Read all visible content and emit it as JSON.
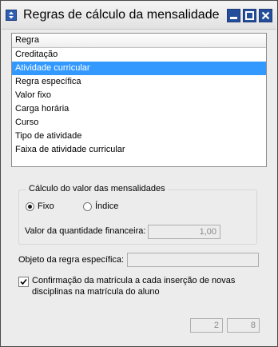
{
  "window": {
    "title": "Regras de cálculo da mensalidade",
    "icons": {
      "app": "app-icon",
      "minimize": "minimize-icon",
      "maximize": "maximize-icon",
      "close": "close-icon"
    }
  },
  "rules_list": {
    "header": "Regra",
    "items": [
      "Creditação",
      "Atividade curricular",
      "Regra específica",
      "Valor fixo",
      "Carga horária",
      "Curso",
      "Tipo de atividade",
      "Faixa de atividade curricular"
    ],
    "selected": "Atividade curricular"
  },
  "calculation": {
    "group_title": "Cálculo do valor das mensalidades",
    "option_fixed": "Fixo",
    "option_index": "Índice",
    "selected_option": "Fixo",
    "financial_quantity_label": "Valor da quantidade financeira:",
    "financial_quantity_value": "1,00"
  },
  "specific_rule": {
    "label": "Objeto da regra específica:",
    "value": ""
  },
  "confirmation": {
    "label_line1": "Confirmação da matrícula a cada inserção de novas",
    "label_line2": "disciplinas na matrícula do aluno",
    "checked": true
  },
  "footer": {
    "value_a": "2",
    "value_b": "8"
  },
  "colors": {
    "selection": "#3399ff",
    "title_buttons": "#244d9a",
    "window_bg": "#ececec"
  }
}
